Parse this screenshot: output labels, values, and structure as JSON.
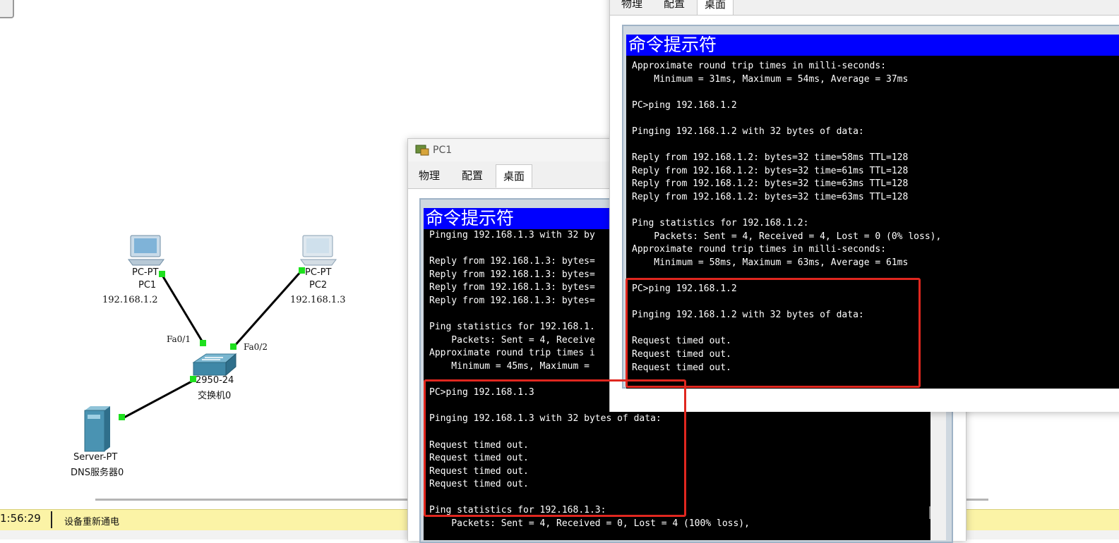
{
  "topology": {
    "pc1": {
      "type": "PC-PT",
      "name": "PC1",
      "ip": "192.168.1.2"
    },
    "pc2": {
      "type": "PC-PT",
      "name": "PC2",
      "ip": "192.168.1.3"
    },
    "switch": {
      "type": "2950-24",
      "name": "交换机0"
    },
    "server": {
      "type": "Server-PT",
      "name": "DNS服务器0"
    },
    "ports": {
      "left": "Fa0/1",
      "right": "Fa0/2"
    },
    "link_color": "#1ee01e"
  },
  "status": {
    "time": "1:56:29",
    "message": "设备重新通电"
  },
  "pc1_window": {
    "title": "PC1",
    "tabs": [
      "物理",
      "配置",
      "桌面"
    ],
    "active_tab": "桌面",
    "cmd_title": "命令提示符",
    "lines": [
      "Pinging 192.168.1.3 with 32 by",
      "",
      "Reply from 192.168.1.3: bytes=",
      "Reply from 192.168.1.3: bytes=",
      "Reply from 192.168.1.3: bytes=",
      "Reply from 192.168.1.3: bytes=",
      "",
      "Ping statistics for 192.168.1.",
      "    Packets: Sent = 4, Receive",
      "Approximate round trip times i",
      "    Minimum = 45ms, Maximum =",
      "",
      "PC>ping 192.168.1.3",
      "",
      "Pinging 192.168.1.3 with 32 bytes of data:",
      "",
      "Request timed out.",
      "Request timed out.",
      "Request timed out.",
      "Request timed out.",
      "",
      "Ping statistics for 192.168.1.3:",
      "    Packets: Sent = 4, Received = 0, Lost = 4 (100% loss),"
    ]
  },
  "pc2_window": {
    "tabs": [
      "物理",
      "配置",
      "桌面"
    ],
    "active_tab": "桌面",
    "cmd_title": "命令提示符",
    "lines": [
      "Approximate round trip times in milli-seconds:",
      "    Minimum = 31ms, Maximum = 54ms, Average = 37ms",
      "",
      "PC>ping 192.168.1.2",
      "",
      "Pinging 192.168.1.2 with 32 bytes of data:",
      "",
      "Reply from 192.168.1.2: bytes=32 time=58ms TTL=128",
      "Reply from 192.168.1.2: bytes=32 time=61ms TTL=128",
      "Reply from 192.168.1.2: bytes=32 time=63ms TTL=128",
      "Reply from 192.168.1.2: bytes=32 time=63ms TTL=128",
      "",
      "Ping statistics for 192.168.1.2:",
      "    Packets: Sent = 4, Received = 4, Lost = 0 (0% loss),",
      "Approximate round trip times in milli-seconds:",
      "    Minimum = 58ms, Maximum = 63ms, Average = 61ms",
      "",
      "PC>ping 192.168.1.2",
      "",
      "Pinging 192.168.1.2 with 32 bytes of data:",
      "",
      "Request timed out.",
      "Request timed out.",
      "Request timed out."
    ]
  },
  "highlight_color": "#e0271f"
}
